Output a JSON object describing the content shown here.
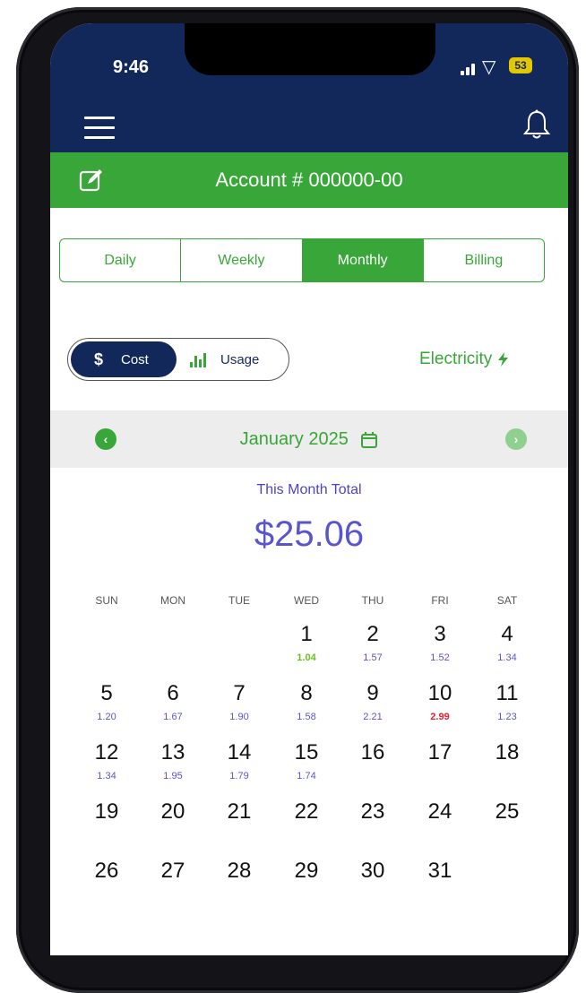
{
  "status_bar": {
    "time": "9:46",
    "battery": "53"
  },
  "header": {
    "account_title": "Account # 000000-00"
  },
  "tabs": [
    {
      "label": "Daily",
      "active": false
    },
    {
      "label": "Weekly",
      "active": false
    },
    {
      "label": "Monthly",
      "active": true
    },
    {
      "label": "Billing",
      "active": false
    }
  ],
  "toggle": {
    "cost_symbol": "$",
    "cost_label": "Cost",
    "usage_label": "Usage",
    "selected": "Cost"
  },
  "utility": {
    "label": "Electricity",
    "icon": "lightning-icon"
  },
  "period": {
    "month_label": "January 2025"
  },
  "summary": {
    "label": "This Month Total",
    "value": "$25.06"
  },
  "calendar": {
    "weekdays": [
      "SUN",
      "MON",
      "TUE",
      "WED",
      "THU",
      "FRI",
      "SAT"
    ],
    "days": [
      {
        "day": "1",
        "value": "1.04",
        "level": "low"
      },
      {
        "day": "2",
        "value": "1.57"
      },
      {
        "day": "3",
        "value": "1.52"
      },
      {
        "day": "4",
        "value": "1.34"
      },
      {
        "day": "5",
        "value": "1.20"
      },
      {
        "day": "6",
        "value": "1.67"
      },
      {
        "day": "7",
        "value": "1.90"
      },
      {
        "day": "8",
        "value": "1.58"
      },
      {
        "day": "9",
        "value": "2.21"
      },
      {
        "day": "10",
        "value": "2.99",
        "level": "high"
      },
      {
        "day": "11",
        "value": "1.23"
      },
      {
        "day": "12",
        "value": "1.34"
      },
      {
        "day": "13",
        "value": "1.95"
      },
      {
        "day": "14",
        "value": "1.79"
      },
      {
        "day": "15",
        "value": "1.74"
      },
      {
        "day": "16"
      },
      {
        "day": "17"
      },
      {
        "day": "18"
      },
      {
        "day": "19"
      },
      {
        "day": "20"
      },
      {
        "day": "21"
      },
      {
        "day": "22"
      },
      {
        "day": "23"
      },
      {
        "day": "24"
      },
      {
        "day": "25"
      },
      {
        "day": "26"
      },
      {
        "day": "27"
      },
      {
        "day": "28"
      },
      {
        "day": "29"
      },
      {
        "day": "30"
      },
      {
        "day": "31"
      }
    ]
  },
  "colors": {
    "navy": "#13285a",
    "green": "#38a638",
    "value_blue": "#5a55cc",
    "low_green": "#6abf1f",
    "high_red": "#e8202c"
  }
}
